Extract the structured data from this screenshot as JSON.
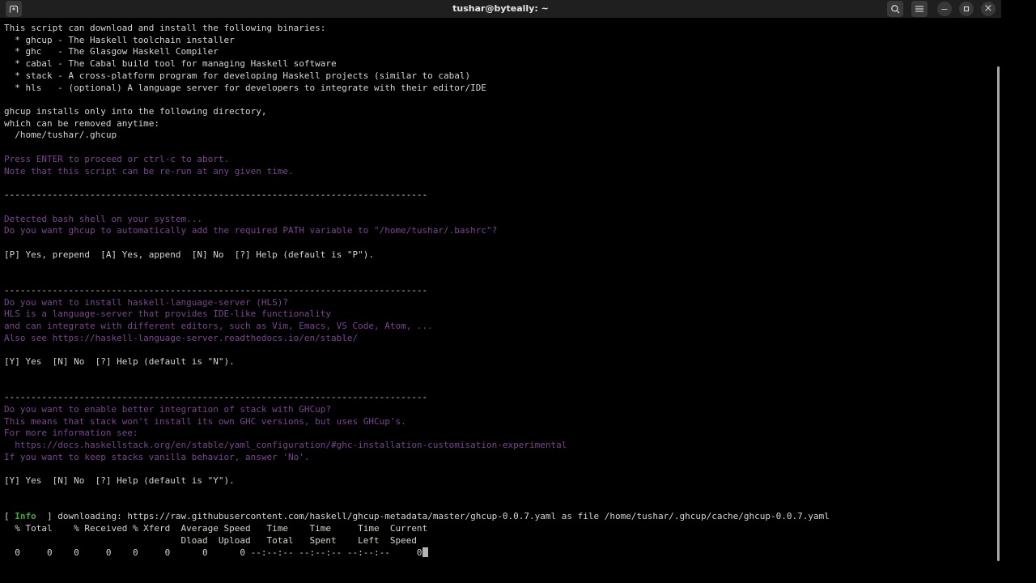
{
  "window": {
    "title": "tushar@byteally: ~",
    "icons": {
      "new_tab": "tab-plus",
      "search": "magnifier",
      "menu": "hamburger",
      "minimize": "−",
      "maximize": "restore-square",
      "close": "×"
    }
  },
  "palette": {
    "background": "#000000",
    "titlebar": "#201f1f",
    "foreground": "#d3d7cf",
    "purple": "#7b4590",
    "green": "#3fae3f",
    "cursor": "#b4b4b4"
  },
  "terminal": {
    "lines": [
      {
        "parts": [
          [
            "fg",
            "This script can download and install the following binaries:"
          ]
        ]
      },
      {
        "parts": [
          [
            "fg",
            "  * ghcup - The Haskell toolchain installer"
          ]
        ]
      },
      {
        "parts": [
          [
            "fg",
            "  * ghc   - The Glasgow Haskell Compiler"
          ]
        ]
      },
      {
        "parts": [
          [
            "fg",
            "  * cabal - The Cabal build tool for managing Haskell software"
          ]
        ]
      },
      {
        "parts": [
          [
            "fg",
            "  * stack - A cross-platform program for developing Haskell projects (similar to cabal)"
          ]
        ]
      },
      {
        "parts": [
          [
            "fg",
            "  * hls   - (optional) A language server for developers to integrate with their editor/IDE"
          ]
        ]
      },
      {
        "parts": []
      },
      {
        "parts": [
          [
            "fg",
            "ghcup installs only into the following directory,"
          ]
        ]
      },
      {
        "parts": [
          [
            "fg",
            "which can be removed anytime:"
          ]
        ]
      },
      {
        "parts": [
          [
            "fg",
            "  /home/tushar/.ghcup"
          ]
        ]
      },
      {
        "parts": []
      },
      {
        "parts": [
          [
            "purple",
            "Press ENTER to proceed or ctrl-c to abort."
          ]
        ]
      },
      {
        "parts": [
          [
            "purple",
            "Note that this script can be re-run at any given time."
          ]
        ]
      },
      {
        "parts": []
      },
      {
        "parts": [
          [
            "fg",
            "-------------------------------------------------------------------------------"
          ]
        ]
      },
      {
        "parts": []
      },
      {
        "parts": [
          [
            "purple",
            "Detected bash shell on your system..."
          ]
        ]
      },
      {
        "parts": [
          [
            "purple",
            "Do you want ghcup to automatically add the required PATH variable to \"/home/tushar/.bashrc\"?"
          ]
        ]
      },
      {
        "parts": []
      },
      {
        "parts": [
          [
            "fg",
            "[P] Yes, prepend  [A] Yes, append  [N] No  [?] Help (default is \"P\")."
          ]
        ]
      },
      {
        "parts": []
      },
      {
        "parts": []
      },
      {
        "parts": [
          [
            "fg",
            "-------------------------------------------------------------------------------"
          ]
        ]
      },
      {
        "parts": [
          [
            "purple",
            "Do you want to install haskell-language-server (HLS)?"
          ]
        ]
      },
      {
        "parts": [
          [
            "purple",
            "HLS is a language-server that provides IDE-like functionality"
          ]
        ]
      },
      {
        "parts": [
          [
            "purple",
            "and can integrate with different editors, such as Vim, Emacs, VS Code, Atom, ..."
          ]
        ]
      },
      {
        "parts": [
          [
            "purple",
            "Also see https://haskell-language-server.readthedocs.io/en/stable/"
          ]
        ]
      },
      {
        "parts": []
      },
      {
        "parts": [
          [
            "fg",
            "[Y] Yes  [N] No  [?] Help (default is \"N\")."
          ]
        ]
      },
      {
        "parts": []
      },
      {
        "parts": []
      },
      {
        "parts": [
          [
            "fg",
            "-------------------------------------------------------------------------------"
          ]
        ]
      },
      {
        "parts": [
          [
            "purple",
            "Do you want to enable better integration of stack with GHCup?"
          ]
        ]
      },
      {
        "parts": [
          [
            "purple",
            "This means that stack won't install its own GHC versions, but uses GHCup's."
          ]
        ]
      },
      {
        "parts": [
          [
            "purple",
            "For more information see:"
          ]
        ]
      },
      {
        "parts": [
          [
            "purple",
            "  https://docs.haskellstack.org/en/stable/yaml_configuration/#ghc-installation-customisation-experimental"
          ]
        ]
      },
      {
        "parts": [
          [
            "purple",
            "If you want to keep stacks vanilla behavior, answer 'No'."
          ]
        ]
      },
      {
        "parts": []
      },
      {
        "parts": [
          [
            "fg",
            "[Y] Yes  [N] No  [?] Help (default is \"Y\")."
          ]
        ]
      },
      {
        "parts": []
      },
      {
        "parts": []
      },
      {
        "parts": [
          [
            "fg",
            "[ "
          ],
          [
            "green",
            "Info"
          ],
          [
            "fg",
            "  ] downloading: https://raw.githubusercontent.com/haskell/ghcup-metadata/master/ghcup-0.0.7.yaml as file /home/tushar/.ghcup/cache/ghcup-0.0.7.yaml"
          ]
        ]
      },
      {
        "parts": [
          [
            "fg",
            "  % Total    % Received % Xferd  Average Speed   Time    Time     Time  Current"
          ]
        ]
      },
      {
        "parts": [
          [
            "fg",
            "                                 Dload  Upload   Total   Spent    Left  Speed"
          ]
        ]
      },
      {
        "parts": [
          [
            "fg",
            "  0     0    0     0    0     0      0      0 --:--:-- --:--:-- --:--:--     0"
          ]
        ],
        "cursor": true
      }
    ]
  }
}
